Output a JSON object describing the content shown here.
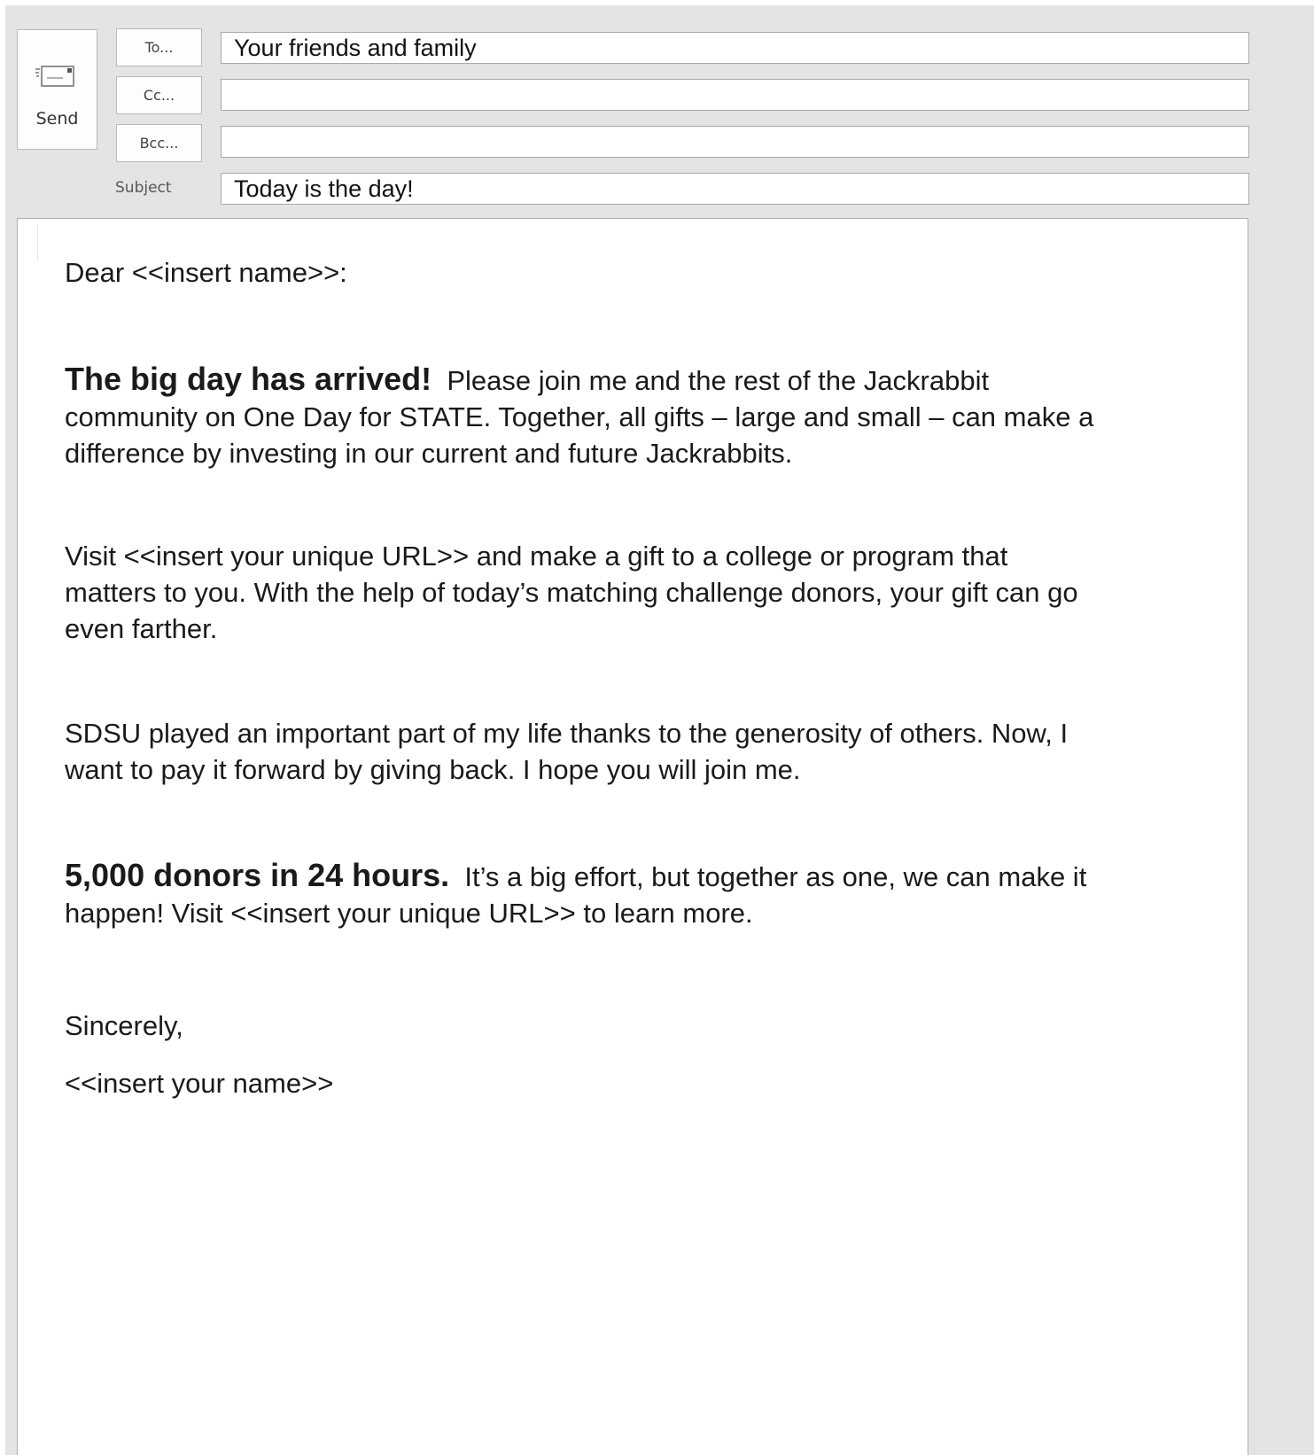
{
  "compose": {
    "send_label": "Send",
    "to_label": "To...",
    "cc_label": "Cc...",
    "bcc_label": "Bcc...",
    "subject_label": "Subject",
    "to_value": "Your friends and family",
    "cc_value": "",
    "bcc_value": "",
    "subject_value": "Today is the day!"
  },
  "message": {
    "greeting": "Dear <<insert name>>:",
    "p1_lead": "The big day has arrived!",
    "p1_line1": "Please join me and the rest of the Jackrabbit",
    "p1_line2": "community on One Day for STATE.  Together, all gifts – large and small – can make a",
    "p1_line3": "difference by investing in our current and future Jackrabbits.",
    "p2_line1": "Visit <<insert your unique URL>> and make a gift to a college or program that",
    "p2_line2": "matters to you.  With the help of today’s matching challenge donors, your gift can go",
    "p2_line3": "even farther.",
    "p3_line1": "SDSU played an important part of my life thanks to the generosity of others.  Now, I",
    "p3_line2": "want to pay it forward by giving back. I hope you will join me.",
    "p4_lead": "5,000 donors in 24 hours.",
    "p4_line1": "It’s a big effort, but together as one, we can make it",
    "p4_line2": "happen!  Visit <<insert your unique URL>> to learn more.",
    "closing": "Sincerely,",
    "signature": "<<insert your name>>"
  },
  "icons": {
    "send": "envelope-send-icon"
  }
}
